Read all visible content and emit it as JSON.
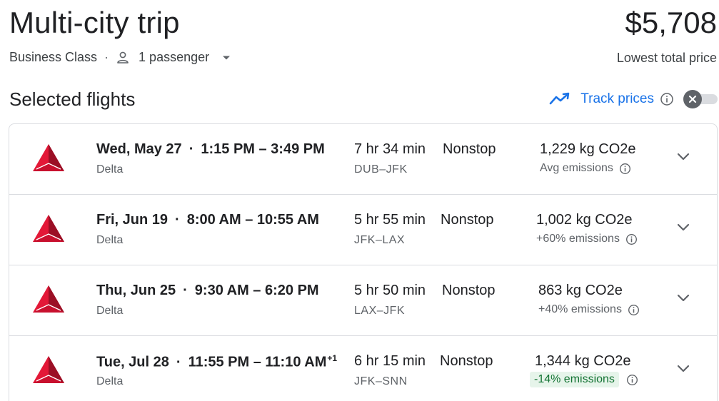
{
  "header": {
    "title": "Multi-city trip",
    "price": "$5,708",
    "cabin": "Business Class",
    "passengers": "1 passenger",
    "price_caption": "Lowest total price"
  },
  "section": {
    "title": "Selected flights",
    "track_label": "Track prices",
    "toggle_state": "off"
  },
  "colors": {
    "accent": "#1a73e8",
    "delta_red": "#c8102e",
    "green_chip_bg": "#e6f4ea",
    "green_chip_text": "#137333"
  },
  "flights": [
    {
      "date": "Wed, May 27",
      "time_range": "1:15 PM – 3:49 PM",
      "day_offset": "",
      "airline": "Delta",
      "duration": "7 hr 34 min",
      "route": "DUB–JFK",
      "stops": "Nonstop",
      "co2": "1,229 kg CO2e",
      "emissions": "Avg emissions",
      "emissions_style": "neutral",
      "icon": "delta-logo-icon"
    },
    {
      "date": "Fri, Jun 19",
      "time_range": "8:00 AM – 10:55 AM",
      "day_offset": "",
      "airline": "Delta",
      "duration": "5 hr 55 min",
      "route": "JFK–LAX",
      "stops": "Nonstop",
      "co2": "1,002 kg CO2e",
      "emissions": "+60% emissions",
      "emissions_style": "neutral",
      "icon": "delta-logo-icon"
    },
    {
      "date": "Thu, Jun 25",
      "time_range": "9:30 AM – 6:20 PM",
      "day_offset": "",
      "airline": "Delta",
      "duration": "5 hr 50 min",
      "route": "LAX–JFK",
      "stops": "Nonstop",
      "co2": "863 kg CO2e",
      "emissions": "+40% emissions",
      "emissions_style": "neutral",
      "icon": "delta-logo-icon"
    },
    {
      "date": "Tue, Jul 28",
      "time_range": "11:55 PM – 11:10 AM",
      "day_offset": "+1",
      "airline": "Delta",
      "duration": "6 hr 15 min",
      "route": "JFK–SNN",
      "stops": "Nonstop",
      "co2": "1,344 kg CO2e",
      "emissions": "-14% emissions",
      "emissions_style": "green",
      "icon": "delta-logo-icon"
    }
  ]
}
